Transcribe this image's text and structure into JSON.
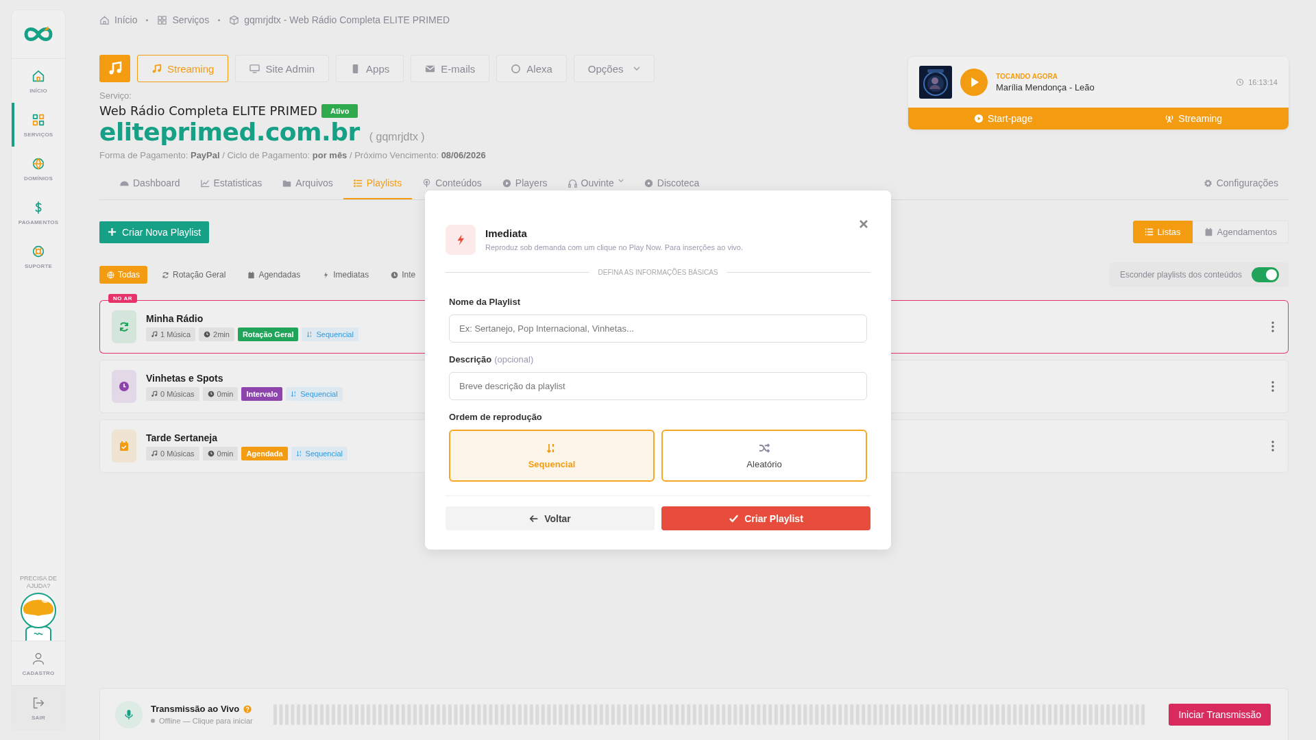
{
  "sidebar": {
    "items": [
      {
        "label": "INÍCIO",
        "selected": false
      },
      {
        "label": "SERVIÇOS",
        "selected": true
      },
      {
        "label": "DOMÍNIOS",
        "selected": false
      },
      {
        "label": "PAGAMENTOS",
        "selected": false
      },
      {
        "label": "SUPORTE",
        "selected": false
      }
    ],
    "help": "PRECISA DE AJUDA?",
    "bottom_items": [
      {
        "label": "CADASTRO"
      },
      {
        "label": "SAIR"
      }
    ]
  },
  "breadcrumb": [
    "Início",
    "Serviços",
    "gqmrjdtx - Web Rádio Completa ELITE PRIMED"
  ],
  "service_buttons": [
    {
      "label": "Streaming",
      "selected": true,
      "kind": "button"
    },
    {
      "label": "Site Admin",
      "selected": false,
      "kind": "button"
    },
    {
      "label": "Apps",
      "selected": false,
      "kind": "button"
    },
    {
      "label": "E-mails",
      "selected": false,
      "kind": "button"
    },
    {
      "label": "Alexa",
      "selected": false,
      "kind": "button"
    },
    {
      "label": "Opções",
      "selected": false,
      "kind": "dropdown"
    }
  ],
  "service": {
    "label": "Serviço:",
    "name": "Web Rádio Completa ELITE PRIMED",
    "status": "Ativo",
    "domain": "eliteprimed.com.br",
    "code": "( gqmrjdtx )",
    "payment": "Forma de Pagamento: **PayPal** / Ciclo de Pagamento: **por mês** / Próximo Vencimento: **08/06/2026**"
  },
  "now_playing": {
    "label": "TOCANDO AGORA",
    "track": "Marília Mendonça - Leão",
    "time": "16:13:14",
    "links": [
      "Start-page",
      "Streaming"
    ]
  },
  "tabs": [
    {
      "label": "Dashboard",
      "selected": false,
      "kind": "tab"
    },
    {
      "label": "Estatisticas",
      "selected": false,
      "kind": "tab"
    },
    {
      "label": "Arquivos",
      "selected": false,
      "kind": "tab"
    },
    {
      "label": "Playlists",
      "selected": true,
      "kind": "tab"
    },
    {
      "label": "Conteúdos",
      "selected": false,
      "kind": "tab"
    },
    {
      "label": "Players",
      "selected": false,
      "kind": "tab"
    },
    {
      "label": "Ouvinte",
      "selected": false,
      "kind": "dropdown"
    },
    {
      "label": "Discoteca",
      "selected": false,
      "kind": "tab"
    }
  ],
  "settings_tab": "Configurações",
  "create_button": "Criar Nova Playlist",
  "view_toggle": [
    {
      "label": "Listas",
      "selected": true
    },
    {
      "label": "Agendamentos",
      "selected": false
    }
  ],
  "filters": [
    {
      "label": "Todas",
      "selected": true
    },
    {
      "label": "Rotação Geral",
      "selected": false
    },
    {
      "label": "Agendadas",
      "selected": false
    },
    {
      "label": "Imediatas",
      "selected": false
    },
    {
      "label": "Inte",
      "selected": false
    }
  ],
  "hide_toggle": {
    "label": "Esconder playlists dos conteúdos",
    "on": true
  },
  "playlists": [
    {
      "name": "Minha Rádio",
      "badge": "NO AR",
      "tracks": "1 Música",
      "duration": "2min",
      "type": "Rotação Geral",
      "color": "#22a35a",
      "order": "Sequencial"
    },
    {
      "name": "Vinhetas e Spots",
      "tracks": "0 Músicas",
      "duration": "0min",
      "type": "Intervalo",
      "color": "#8e44ad",
      "order": "Sequencial"
    },
    {
      "name": "Tarde Sertaneja",
      "tracks": "0 Músicas",
      "duration": "0min",
      "type": "Agendada",
      "color": "#f39c12",
      "order": "Sequencial"
    }
  ],
  "modal": {
    "title": "Imediata",
    "subtitle": "Reproduz sob demanda com um clique no Play Now. Para inserções ao vivo.",
    "section": "DEFINA AS INFORMAÇÕES BÁSICAS",
    "fields": [
      {
        "label": "Nome da Playlist",
        "placeholder": "Ex: Sertanejo, Pop Internacional, Vinhetas..."
      },
      {
        "label": "Descrição",
        "hint": "(opcional)",
        "placeholder": "Breve descrição da playlist"
      }
    ],
    "order_label": "Ordem de reprodução",
    "order_options": [
      {
        "label": "Sequencial",
        "selected": true
      },
      {
        "label": "Aleatório",
        "selected": false
      }
    ],
    "back": "Voltar",
    "submit": "Criar Playlist"
  },
  "live_bar": {
    "title": "Transmissão ao Vivo",
    "status": "Offline — Clique para iniciar",
    "live": false,
    "button": "Iniciar Transmissão"
  }
}
